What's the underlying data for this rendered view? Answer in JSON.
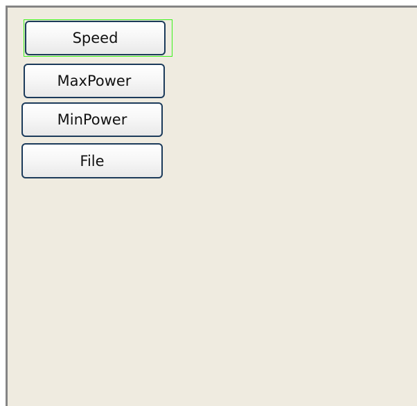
{
  "menu": {
    "items": [
      {
        "label": "Speed",
        "selected": true
      },
      {
        "label": "MaxPower",
        "selected": false
      },
      {
        "label": "MinPower",
        "selected": false
      },
      {
        "label": "File",
        "selected": false
      }
    ]
  },
  "colors": {
    "panel_background": "#efebe0",
    "button_border": "#1b3a5a",
    "focus_outline": "#3cf21a",
    "frame_border": "#848484"
  }
}
